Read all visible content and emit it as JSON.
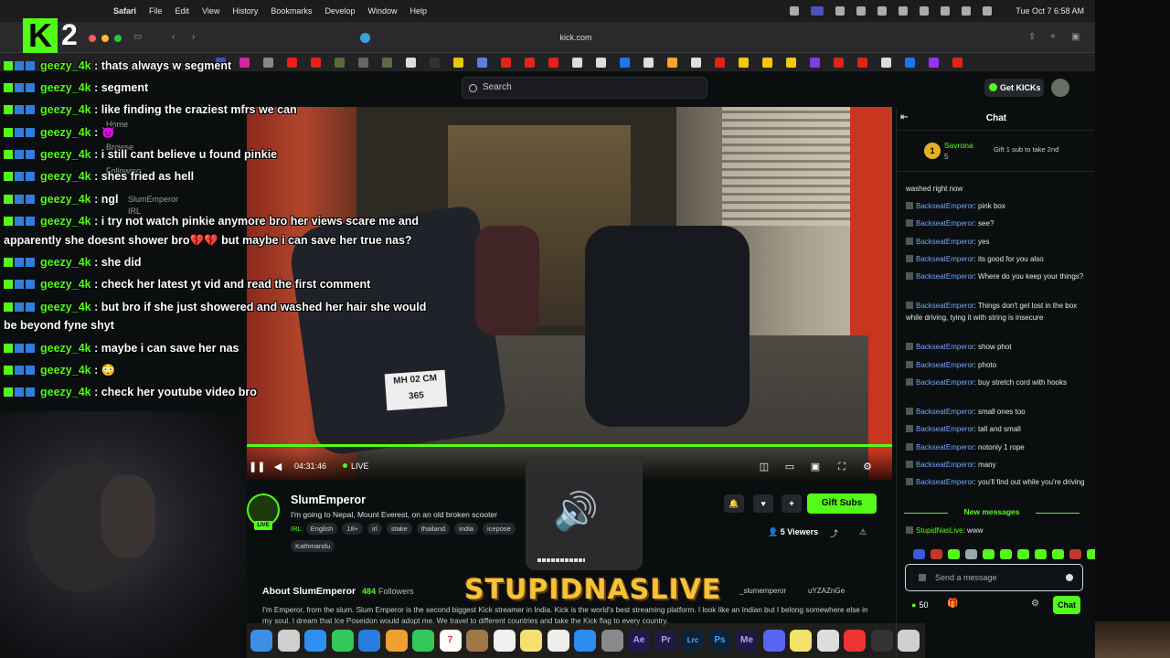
{
  "menubar": {
    "app": "Safari",
    "items": [
      "File",
      "Edit",
      "View",
      "History",
      "Bookmarks",
      "Develop",
      "Window",
      "Help"
    ],
    "clock": "Tue Oct 7  6:58 AM"
  },
  "browser": {
    "url": "kick.com"
  },
  "site": {
    "search_placeholder": "Search",
    "get_kicks": "Get KICKs"
  },
  "overlay": {
    "logo_number": "2",
    "chat": [
      {
        "user": "geezy_4k",
        "msg": " : thats always w segment"
      },
      {
        "user": "geezy_4k",
        "msg": " : segment"
      },
      {
        "user": "geezy_4k",
        "msg": " : like finding the craziest mfrs we can"
      },
      {
        "user": "geezy_4k",
        "msg": " : 😈"
      },
      {
        "user": "geezy_4k",
        "msg": " : i still cant believe u found pinkie"
      },
      {
        "user": "geezy_4k",
        "msg": " : shes fried as hell"
      },
      {
        "user": "geezy_4k",
        "msg": " : ngl"
      },
      {
        "user": "geezy_4k",
        "msg": " : i try not watch pinkie anymore bro her views scare me and"
      },
      {
        "user": "",
        "msg": "apparently she doesnt shower bro💔💔 but maybe i can save her true nas?"
      },
      {
        "user": "geezy_4k",
        "msg": " : she did"
      },
      {
        "user": "geezy_4k",
        "msg": " : check her latest yt vid and read the first comment"
      },
      {
        "user": "geezy_4k",
        "msg": " : but bro if she just showered and washed her hair she would"
      },
      {
        "user": "",
        "msg": "be beyond fyne shyt"
      },
      {
        "user": "geezy_4k",
        "msg": " : maybe i can save her nas"
      },
      {
        "user": "geezy_4k",
        "msg": " : 😳"
      },
      {
        "user": "geezy_4k",
        "msg": " : check her youtube video bro"
      }
    ],
    "ghost_nav": [
      "Home",
      "Browse",
      "Following",
      "SlumEmperor",
      "IRL"
    ],
    "banner": "STUPIDNASLIVE"
  },
  "player": {
    "time": "04:31:46",
    "live": "LIVE",
    "plate": "MH 02 CM 365"
  },
  "stream": {
    "name": "SlumEmperor",
    "title": "I'm going to Nepal, Mount Everest, on an old broken scooter",
    "category": "IRL",
    "tags": [
      "English",
      "18+",
      "irl",
      "stake",
      "thailand",
      "india",
      "icepose"
    ],
    "tag_row2": "Kathmandu",
    "viewers": "5 Viewers",
    "gift_subs": "Gift Subs",
    "about_title": "About SlumEmperor",
    "followers_count": "484",
    "followers_label": "Followers",
    "socials": [
      "_slumemperor",
      "uYZAZnGe"
    ],
    "bio": "I'm Emperor, from the slum. Slum Emperor is the second biggest Kick streamer in India. Kick is the world's best streaming platform. I look like an Indian but I belong somewhere else in my soul. I dream that Ice Poseidon would adopt me. We travel to different countries and take the Kick flag to every country."
  },
  "chat": {
    "title": "Chat",
    "pinned": {
      "rank": "1",
      "name": "Savrona",
      "count": "5",
      "desc": "Gift 1 sub to take 2nd"
    },
    "messages": [
      {
        "user": "",
        "text": "washed right now"
      },
      {
        "user": "BackseatEmperor",
        "text": ": pink box"
      },
      {
        "user": "BackseatEmperor",
        "text": ": see?"
      },
      {
        "user": "BackseatEmperor",
        "text": ": yes"
      },
      {
        "user": "BackseatEmperor",
        "text": ": its good for you also"
      },
      {
        "user": "BackseatEmperor",
        "text": ": Where do you keep your things?"
      },
      {
        "user": "BackseatEmperor",
        "text": ": Things don't get lost in the box while driving, tying it with string is insecure"
      },
      {
        "user": "BackseatEmperor",
        "text": ": show phot"
      },
      {
        "user": "BackseatEmperor",
        "text": ": photo"
      },
      {
        "user": "BackseatEmperor",
        "text": ": buy stretch cord with hooks"
      },
      {
        "user": "BackseatEmperor",
        "text": ": small ones too"
      },
      {
        "user": "BackseatEmperor",
        "text": ": tall and small"
      },
      {
        "user": "BackseatEmperor",
        "text": ": notonly 1 rope"
      },
      {
        "user": "BackseatEmperor",
        "text": ": many"
      },
      {
        "user": "BackseatEmperor",
        "text": ": you'll find out while you're driving"
      }
    ],
    "new_messages": "New messages",
    "last": {
      "user": "StupidNasLive",
      "text": ": www"
    },
    "send_placeholder": "Send a message",
    "points": "50",
    "send_button": "Chat"
  },
  "dock": {
    "apps": [
      "Finder",
      "Launchpad",
      "Safari",
      "Messages",
      "Mail",
      "Photos",
      "FaceTime",
      "Calendar",
      "Notes",
      "Reminders",
      "Freeform",
      "App Store",
      "Settings",
      "Ae",
      "Pr",
      "Lrc",
      "Ps",
      "Me",
      "Discord",
      "Stickies",
      "Chrome",
      "Terminal",
      "Trash"
    ]
  }
}
